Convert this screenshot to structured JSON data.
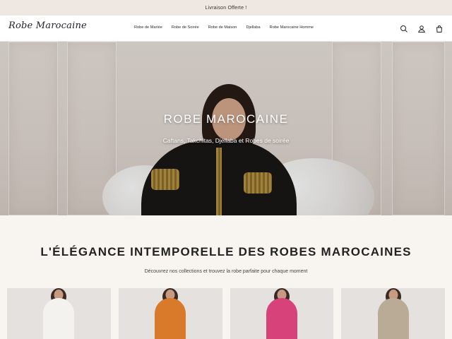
{
  "announcement": "Livraison Offerte !",
  "header": {
    "logo": "Robe Marocaine",
    "nav": [
      "Robe de Mariée",
      "Robe de Soirée",
      "Robe de Maison",
      "Djellaba",
      "Robe Marocaine Homme"
    ],
    "icons": [
      "search-icon",
      "account-icon",
      "cart-icon"
    ]
  },
  "hero": {
    "title": "ROBE MAROCAINE",
    "subtitle": "Caftans, Takchitas, Djellaba et Robes de soirée"
  },
  "collection": {
    "title": "L'ÉLÉGANCE INTEMPORELLE DES ROBES MAROCAINES",
    "subtitle": "Découvrez nos collections et trouvez la robe parfaite pour chaque moment",
    "cards": [
      {
        "dress_color": "#f4f2ef"
      },
      {
        "dress_color": "#d97a2b"
      },
      {
        "dress_color": "#d8427a"
      },
      {
        "dress_color": "#b9ab95"
      }
    ]
  },
  "colors": {
    "announcement_bg": "#efe7e1",
    "page_bg": "#f8f5f1",
    "text": "#222222"
  }
}
